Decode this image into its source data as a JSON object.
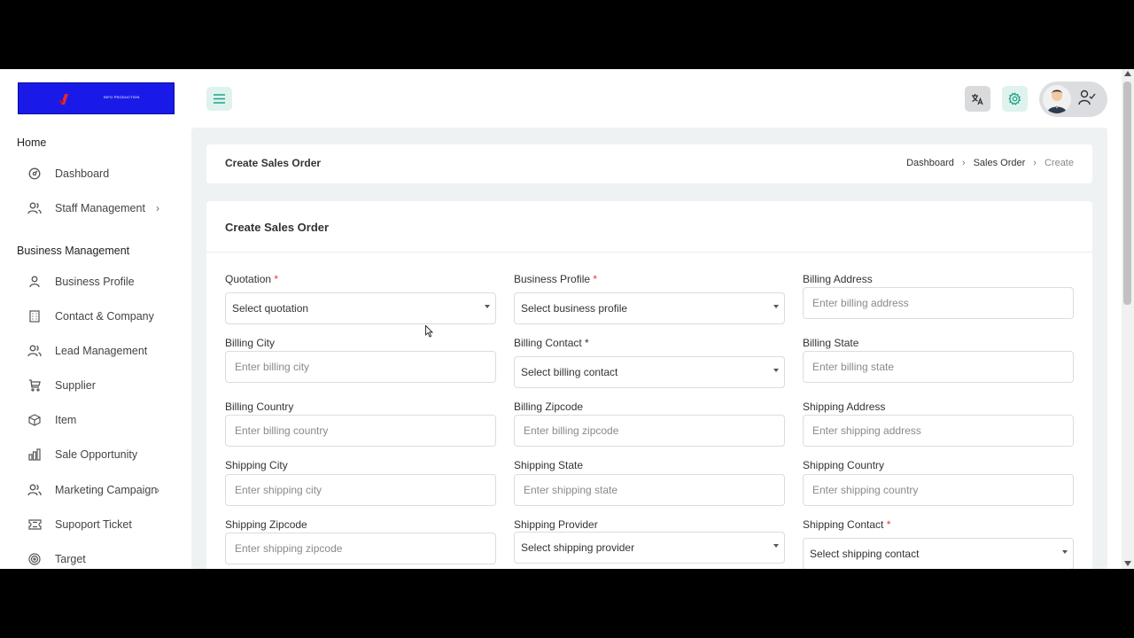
{
  "logo": {
    "text": "INFO PRODUCTION"
  },
  "sidebar": {
    "sections": [
      {
        "title": "Home"
      },
      {
        "title": "Business Management"
      }
    ],
    "home_items": [
      {
        "label": "Dashboard",
        "icon": "dashboard-icon"
      },
      {
        "label": "Staff Management",
        "icon": "users-icon",
        "has_children": true
      }
    ],
    "business_items": [
      {
        "label": "Business Profile",
        "icon": "user-icon"
      },
      {
        "label": "Contact & Company",
        "icon": "building-icon"
      },
      {
        "label": "Lead Management",
        "icon": "users-icon"
      },
      {
        "label": "Supplier",
        "icon": "cart-icon"
      },
      {
        "label": "Item",
        "icon": "box-icon"
      },
      {
        "label": "Sale Opportunity",
        "icon": "bar-chart-icon"
      },
      {
        "label": "Marketing Campaign",
        "icon": "users-icon",
        "has_children": true
      },
      {
        "label": "Supoport Ticket",
        "icon": "ticket-icon"
      },
      {
        "label": "Target",
        "icon": "target-icon"
      }
    ]
  },
  "header": {
    "page_title": "Create Sales Order",
    "breadcrumb": [
      "Dashboard",
      "Sales Order",
      "Create"
    ]
  },
  "form": {
    "title": "Create Sales Order",
    "fields": [
      {
        "label": "Quotation",
        "required": true,
        "type": "select",
        "value": "Select quotation"
      },
      {
        "label": "Business Profile",
        "required": true,
        "type": "select",
        "value": "Select business profile"
      },
      {
        "label": "Billing Address",
        "required": false,
        "type": "input",
        "placeholder": "Enter billing address"
      },
      {
        "label": "Billing City",
        "required": false,
        "type": "input",
        "placeholder": "Enter billing city"
      },
      {
        "label": "Billing Contact *",
        "required": false,
        "type": "select",
        "value": "Select billing contact"
      },
      {
        "label": "Billing State",
        "required": false,
        "type": "input",
        "placeholder": "Enter billing state"
      },
      {
        "label": "Billing Country",
        "required": false,
        "type": "input",
        "placeholder": "Enter billing country"
      },
      {
        "label": "Billing Zipcode",
        "required": false,
        "type": "input",
        "placeholder": "Enter billing zipcode"
      },
      {
        "label": "Shipping Address",
        "required": false,
        "type": "input",
        "placeholder": "Enter shipping address"
      },
      {
        "label": "Shipping City",
        "required": false,
        "type": "input",
        "placeholder": "Enter shipping city"
      },
      {
        "label": "Shipping State",
        "required": false,
        "type": "input",
        "placeholder": "Enter shipping state"
      },
      {
        "label": "Shipping Country",
        "required": false,
        "type": "input",
        "placeholder": "Enter shipping country"
      },
      {
        "label": "Shipping Zipcode",
        "required": false,
        "type": "input",
        "placeholder": "Enter shipping zipcode"
      },
      {
        "label": "Shipping Provider",
        "required": false,
        "type": "select",
        "value": "Select shipping provider"
      },
      {
        "label": "Shipping Contact",
        "required": true,
        "type": "select",
        "value": "Select shipping contact"
      }
    ]
  },
  "colors": {
    "accent": "#20a08a",
    "required": "#e53935",
    "logo_bg": "#1a1ae8",
    "content_bg": "#eef2f3"
  }
}
